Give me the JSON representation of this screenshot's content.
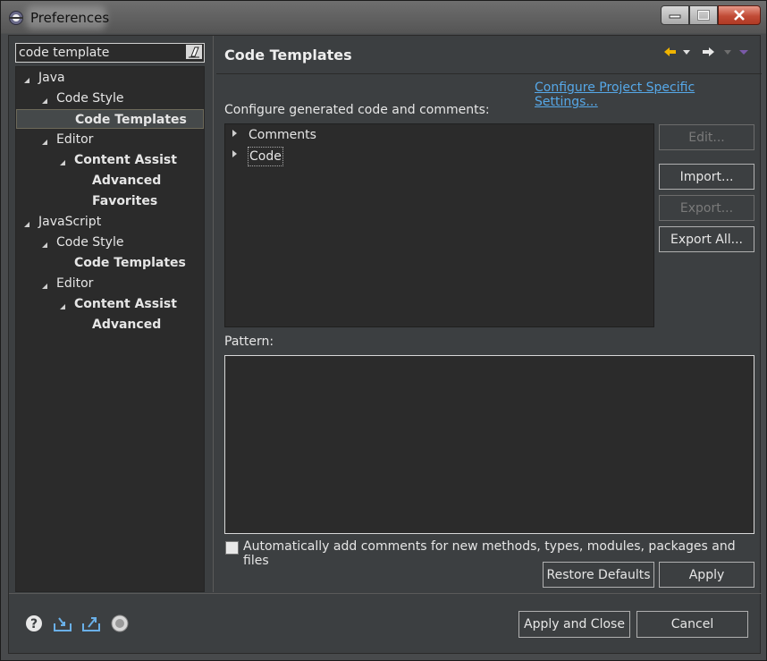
{
  "window": {
    "title": "Preferences"
  },
  "filter": {
    "value": "code template"
  },
  "tree": [
    {
      "label": "Java",
      "indent": 0,
      "bold": false,
      "expanded": true
    },
    {
      "label": "Code Style",
      "indent": 1,
      "bold": false,
      "expanded": true
    },
    {
      "label": "Code Templates",
      "indent": 2,
      "bold": true,
      "selected": true
    },
    {
      "label": "Editor",
      "indent": 1,
      "bold": false,
      "expanded": true
    },
    {
      "label": "Content Assist",
      "indent": 2,
      "bold": true,
      "expanded": true
    },
    {
      "label": "Advanced",
      "indent": 3,
      "bold": true
    },
    {
      "label": "Favorites",
      "indent": 3,
      "bold": true
    },
    {
      "label": "JavaScript",
      "indent": 0,
      "bold": false,
      "expanded": true
    },
    {
      "label": "Code Style",
      "indent": 1,
      "bold": false,
      "expanded": true
    },
    {
      "label": "Code Templates",
      "indent": 2,
      "bold": true
    },
    {
      "label": "Editor",
      "indent": 1,
      "bold": false,
      "expanded": true
    },
    {
      "label": "Content Assist",
      "indent": 2,
      "bold": true,
      "expanded": true
    },
    {
      "label": "Advanced",
      "indent": 3,
      "bold": true
    }
  ],
  "page": {
    "title": "Code Templates",
    "project_link": "Configure Project Specific Settings...",
    "configure_label": "Configure generated code and comments:",
    "templates": [
      "Comments",
      "Code"
    ],
    "buttons": {
      "edit": "Edit...",
      "import": "Import...",
      "export": "Export...",
      "export_all": "Export All..."
    },
    "pattern_label": "Pattern:",
    "auto_comments_label": "Automatically add comments for new methods, types, modules, packages and files",
    "auto_comments_checked": false,
    "restore_defaults": "Restore Defaults",
    "apply": "Apply"
  },
  "footer": {
    "apply_close": "Apply and Close",
    "cancel": "Cancel",
    "icons": [
      "help-icon",
      "import-preferences-icon",
      "export-preferences-icon",
      "oomph-recorder-icon"
    ]
  },
  "colors": {
    "link": "#56a8e8",
    "background": "#3c3f41",
    "tree_bg": "#2b2b2b",
    "nav_arrow": "#f0b400"
  }
}
